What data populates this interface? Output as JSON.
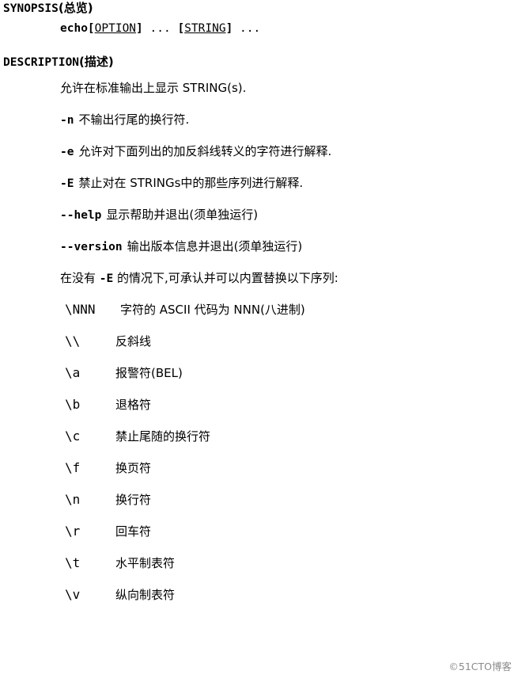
{
  "document": {
    "sections": [
      {
        "id": "synopsis",
        "heading_en": "SYNOPSIS",
        "heading_cjk": "(总览)",
        "synopsis": {
          "command": "echo",
          "option_bracket_open": "[",
          "option": "OPTION",
          "option_bracket_close": "]",
          "ellipsis1": " ... ",
          "string_bracket_open": "[",
          "string": "STRING",
          "string_bracket_close": "]",
          "ellipsis2": " ..."
        }
      },
      {
        "id": "description",
        "heading_en": "DESCRIPTION",
        "heading_cjk": "(描述)",
        "intro": "允许在标准输出上显示 STRING(s).",
        "options": [
          {
            "flag": "-n",
            "text": "不输出行尾的换行符."
          },
          {
            "flag": "-e",
            "text": "允许对下面列出的加反斜线转义的字符进行解释."
          },
          {
            "flag": "-E",
            "text": "禁止对在 STRINGs中的那些序列进行解释."
          },
          {
            "flag": "--help",
            "text": "显示帮助并退出(须单独运行)"
          },
          {
            "flag": "--version",
            "text": "输出版本信息并退出(须单独运行)"
          }
        ],
        "escapes_intro_before": "在没有 ",
        "escapes_intro_flag": "-E",
        "escapes_intro_after": " 的情况下,可承认并可以内置替换以下序列:",
        "escapes": [
          {
            "token": "\\NNN",
            "text": "字符的 ASCII 代码为 NNN(八进制)"
          },
          {
            "token": "\\\\",
            "text": "反斜线"
          },
          {
            "token": "\\a",
            "text": "报警符(BEL)"
          },
          {
            "token": "\\b",
            "text": "退格符"
          },
          {
            "token": "\\c",
            "text": "禁止尾随的换行符"
          },
          {
            "token": "\\f",
            "text": "换页符"
          },
          {
            "token": "\\n",
            "text": "换行符"
          },
          {
            "token": "\\r",
            "text": "回车符"
          },
          {
            "token": "\\t",
            "text": "水平制表符"
          },
          {
            "token": "\\v",
            "text": "纵向制表符"
          }
        ]
      }
    ]
  },
  "watermark": "©51CTO博客"
}
